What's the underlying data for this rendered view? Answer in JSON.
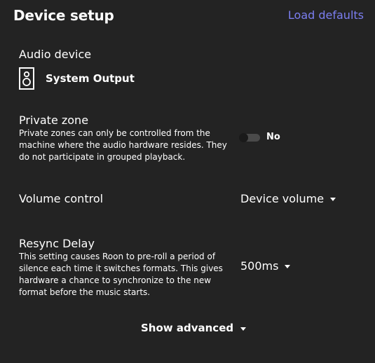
{
  "header": {
    "title": "Device setup",
    "load_defaults": "Load defaults"
  },
  "audio_device": {
    "label": "Audio device",
    "icon": "speaker-icon",
    "device_name": "System Output"
  },
  "private_zone": {
    "label": "Private zone",
    "description": "Private zones can only be controlled from the machine where the audio hardware resides. They do not participate in grouped playback.",
    "toggle_state": "No"
  },
  "volume_control": {
    "label": "Volume control",
    "value": "Device volume"
  },
  "resync_delay": {
    "label": "Resync Delay",
    "description": "This setting causes Roon to pre-roll a period of silence each time it switches formats. This gives hardware a chance to synchronize to the new format before the music starts.",
    "value": "500ms"
  },
  "footer": {
    "show_advanced": "Show advanced"
  },
  "colors": {
    "background": "#232323",
    "accent": "#7b7ef0"
  }
}
